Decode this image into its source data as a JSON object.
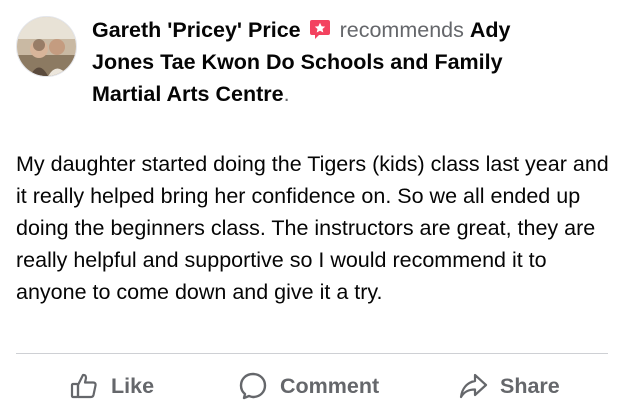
{
  "post": {
    "author_name": "Gareth 'Pricey' Price",
    "recommends_text": "recommends",
    "page_name": "Ady Jones Tae Kwon Do Schools and Family Martial Arts Centre",
    "period": ".",
    "review_text": "My daughter started doing the Tigers (kids) class last year and it really helped bring her confidence on. So we all ended up doing the beginners class. The instructors are great, they are really helpful and supportive so I would recommend it to anyone to come down and give it a try."
  },
  "actions": {
    "like_label": "Like",
    "comment_label": "Comment",
    "share_label": "Share"
  },
  "icons": {
    "avatar": "avatar-photo",
    "recommend": "recommend-star-icon",
    "like": "thumbs-up-icon",
    "comment": "comment-bubble-icon",
    "share": "share-arrow-icon"
  },
  "colors": {
    "primary_text": "#050505",
    "secondary_text": "#65676b",
    "recommend_badge": "#f3425f",
    "divider": "#ced0d4"
  }
}
